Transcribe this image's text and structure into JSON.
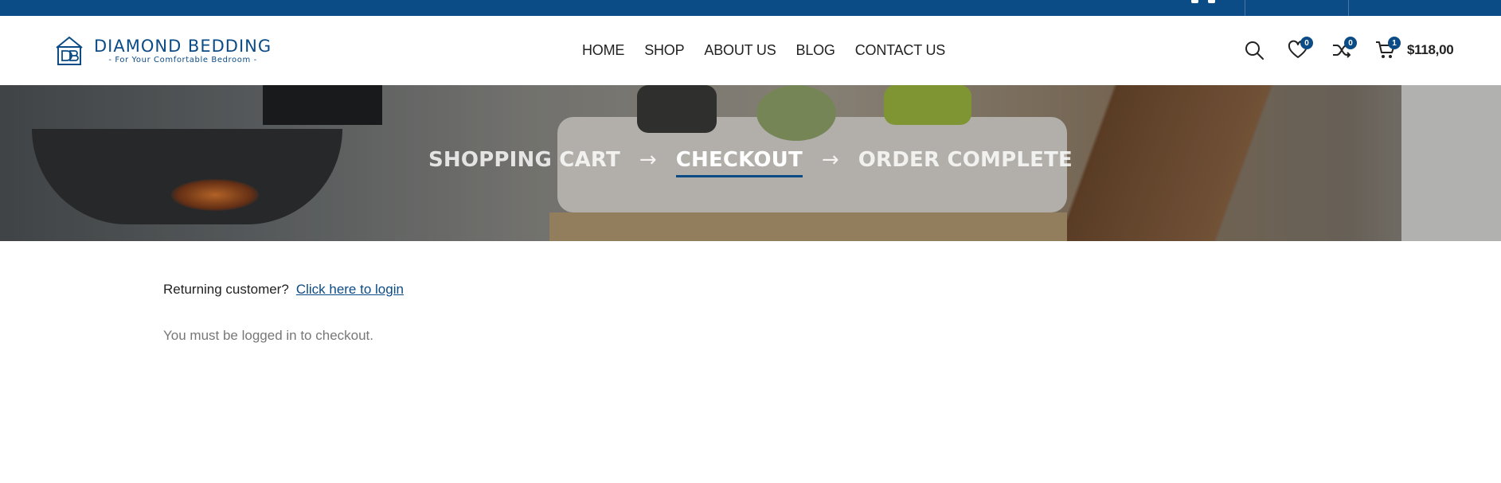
{
  "topbar": {
    "icons": [
      "facebook-icon",
      "instagram-icon"
    ]
  },
  "brand": {
    "name": "DIAMOND BEDDING",
    "tagline": "- For Your Comfortable Bedroom -",
    "color": "#0b4b86"
  },
  "nav": {
    "items": [
      {
        "label": "HOME"
      },
      {
        "label": "SHOP"
      },
      {
        "label": "ABOUT US"
      },
      {
        "label": "BLOG"
      },
      {
        "label": "CONTACT US"
      }
    ]
  },
  "header_tools": {
    "search_icon": "search-icon",
    "wishlist_count": "0",
    "compare_count": "0",
    "cart_count": "1",
    "cart_total": "$118,00"
  },
  "checkout_steps": {
    "step1": "SHOPPING CART",
    "step2": "CHECKOUT",
    "step3": "ORDER COMPLETE",
    "arrow": "→",
    "active": "CHECKOUT"
  },
  "login_notice": {
    "question": "Returning customer?",
    "link": "Click here to login"
  },
  "checkout_message": "You must be logged in to checkout."
}
